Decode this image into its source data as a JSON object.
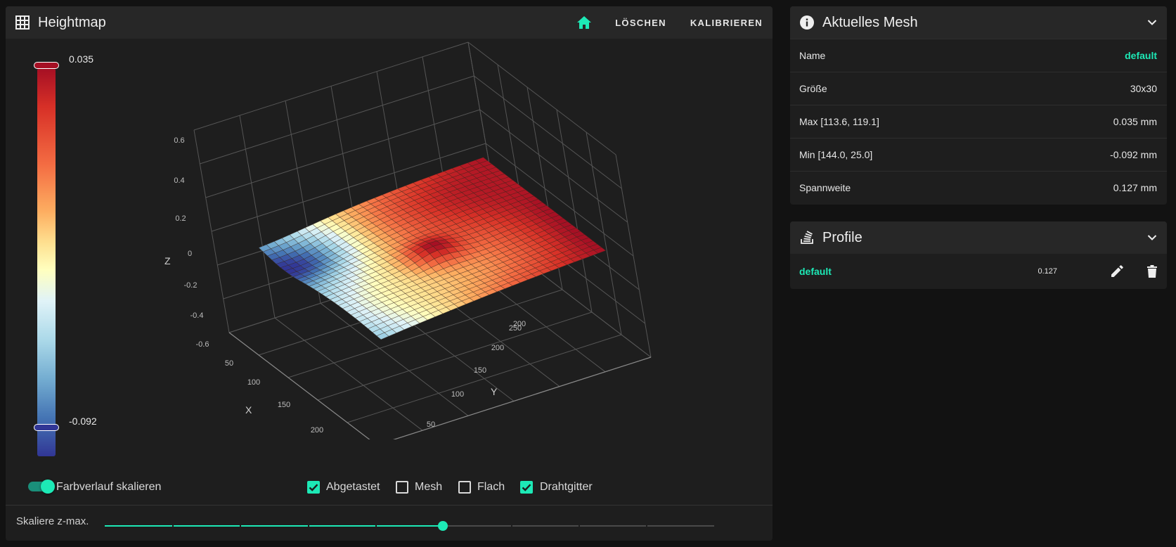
{
  "heightmap": {
    "title": "Heightmap",
    "icon": "grid-icon",
    "actions": {
      "home_icon": "home-icon",
      "clear_label": "LÖSCHEN",
      "calibrate_label": "KALIBRIEREN"
    },
    "colorbar": {
      "max_label": "0.035",
      "min_label": "-0.092",
      "max_color": "#a50f24",
      "min_color": "#313695"
    },
    "plot": {
      "z_label": "Z",
      "x_label": "X",
      "y_label": "Y",
      "z_ticks": [
        "0.6",
        "0.4",
        "0.2",
        "0",
        "-0.2",
        "-0.4",
        "-0.6"
      ],
      "x_ticks": [
        "50",
        "100",
        "150",
        "200"
      ],
      "y_ticks": [
        "50",
        "100",
        "150",
        "200",
        "250"
      ],
      "y_ticks_overlap": "200"
    },
    "controls": {
      "scale_gradient_label": "Farbverlauf skalieren",
      "scale_gradient_on": true,
      "checkboxes": [
        {
          "label": "Abgetastet",
          "checked": true
        },
        {
          "label": "Mesh",
          "checked": false
        },
        {
          "label": "Flach",
          "checked": false
        },
        {
          "label": "Drahtgitter",
          "checked": true
        }
      ],
      "scale_zmax_label": "Skaliere z-max.",
      "scale_zmax_value": 0.555
    },
    "accent_color": "#1de9b6"
  },
  "current_mesh": {
    "title": "Aktuelles Mesh",
    "icon": "info-icon",
    "rows": [
      {
        "key": "Name",
        "value": "default"
      },
      {
        "key": "Größe",
        "value": "30x30"
      },
      {
        "key": "Max [113.6, 119.1]",
        "value": "0.035 mm"
      },
      {
        "key": "Min [144.0, 25.0]",
        "value": "-0.092 mm"
      },
      {
        "key": "Spannweite",
        "value": "0.127 mm"
      }
    ]
  },
  "profiles": {
    "title": "Profile",
    "icon": "stack-icon",
    "items": [
      {
        "name": "default",
        "range": "0.127"
      }
    ]
  }
}
